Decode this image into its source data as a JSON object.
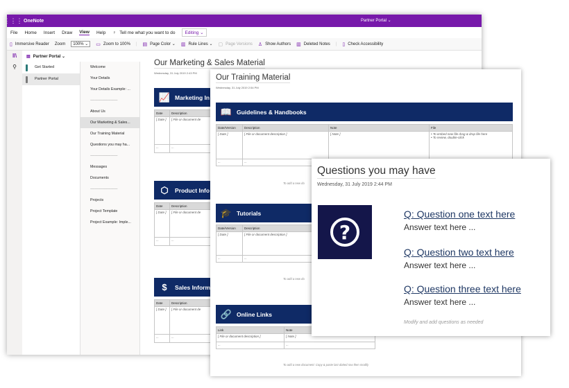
{
  "app": {
    "name": "OneNote",
    "account": "Partner Portal ⌄"
  },
  "menu": {
    "file": "File",
    "home": "Home",
    "insert": "Insert",
    "draw": "Draw",
    "view": "View",
    "help": "Help",
    "tell": "Tell me what you want to do",
    "editing": "Editing ⌄"
  },
  "toolbar": {
    "immersive": "Immersive Reader",
    "zoom_label": "Zoom",
    "zoom_value": "100% ⌄",
    "zoom100": "Zoom to 100%",
    "page_color": "Page Color ⌄",
    "rule_lines": "Rule Lines ⌄",
    "page_versions": "Page Versions",
    "show_authors": "Show Authors",
    "deleted_notes": "Deleted Notes",
    "check_access": "Check Accessibility"
  },
  "notebook": {
    "name": "Partner Portal ⌄"
  },
  "sections": [
    {
      "label": "Get Started",
      "color": "#2b7a78"
    },
    {
      "label": "Partner Portal",
      "color": "#7a7a7a"
    }
  ],
  "pages": [
    "Welcome",
    "Your Details",
    "Your Details Example: ...",
    "-------------------------------",
    "About Us",
    "Our Marketing & Sales...",
    "Our Training Material",
    "Questions you may ha...",
    "-------------------------------",
    "Messages",
    "Documents",
    "-------------------------------",
    "Projects",
    "Project Template",
    "Project Example: Imple..."
  ],
  "page1": {
    "title": "Our Marketing & Sales Material",
    "date": "Wednesday, 31 July 2019   2:43 PM",
    "banners": [
      "Marketing In",
      "Product Info",
      "Sales Informa"
    ],
    "headers": [
      "Date",
      "Description"
    ],
    "date_ph": "[ Date ]",
    "desc_ph": "[ File or document de",
    "desc_ph2": "[ File or document de",
    "desc_ph3": "[ File or document de",
    "dots": "..."
  },
  "page2": {
    "title": "Our Training Material",
    "date": "Wednesday, 31 July 2019   2:54 PM",
    "banners": [
      "Guidelines & Handbooks",
      "Tutorials",
      "Online Links"
    ],
    "gh_headers": [
      "Date/Version",
      "Description",
      "Note",
      "File"
    ],
    "tut_headers": [
      "Date/Version",
      "Description"
    ],
    "link_headers": [
      "Link",
      "Note"
    ],
    "date_ph": "[ Date ]",
    "desc_ph": "[ File or document description ]",
    "note_ph": "[ Note ]",
    "file_b1": "To embed new file drag & drop file here",
    "file_b2": "To review, double-click",
    "dots": "...",
    "hint_short": "To add a new do",
    "hint_full": "To add a new document: Copy & paste last dotted row then modify"
  },
  "page3": {
    "title": "Questions you may have",
    "date": "Wednesday, 31 July 2019   2:44 PM",
    "q1": "Q: Question one text here",
    "a1": "Answer text here ...",
    "q2": "Q: Question two text here",
    "a2": "Answer text here ...",
    "q3": "Q: Question three text here",
    "a3": "Answer text here ...",
    "note": "Modify and add questions as needed"
  },
  "colors": {
    "brand": "#7719aa",
    "banner": "#0f2a66",
    "question_icon": "#14164a"
  }
}
